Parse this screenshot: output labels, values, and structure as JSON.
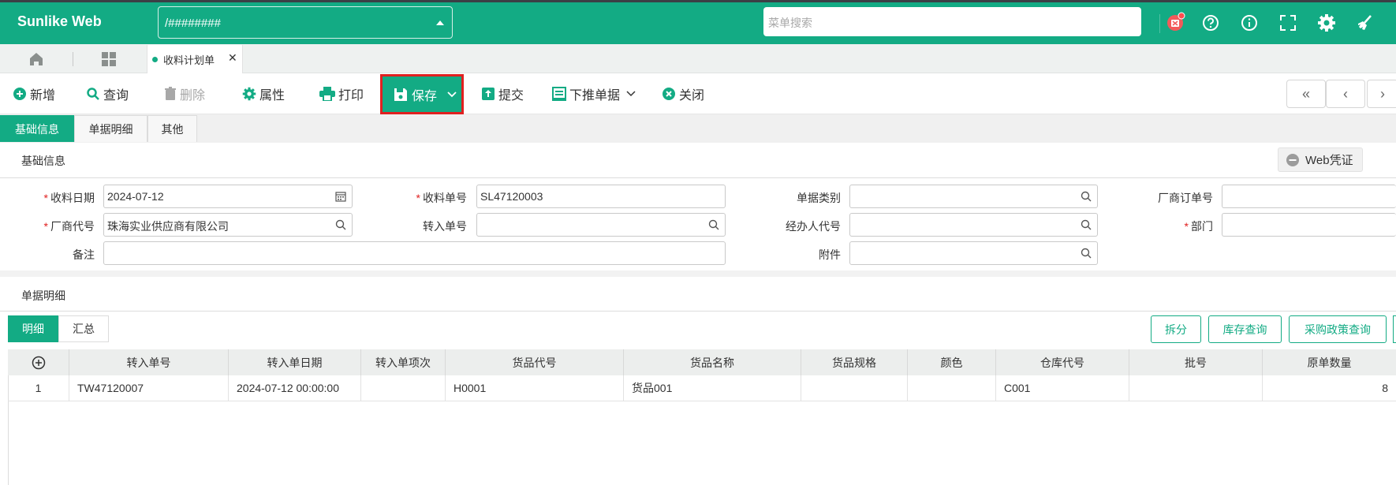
{
  "app": {
    "brand": "Sunlike Web",
    "path_value": "/########",
    "menu_search_placeholder": "菜单搜索"
  },
  "tabs": {
    "page_tab_label": "收料计划单"
  },
  "toolbar": {
    "add": "新增",
    "query": "查询",
    "delete": "删除",
    "properties": "属性",
    "print": "打印",
    "save": "保存",
    "submit": "提交",
    "push_down": "下推单据",
    "close": "关闭"
  },
  "subtabs": [
    "基础信息",
    "单据明细",
    "其他"
  ],
  "basic": {
    "section_title": "基础信息",
    "web_voucher": "Web凭证",
    "fields": {
      "receive_date": {
        "label": "收料日期",
        "value": "2024-07-12"
      },
      "receive_no": {
        "label": "收料单号",
        "value": "SL47120003"
      },
      "doc_type": {
        "label": "单据类别",
        "value": ""
      },
      "vendor_order_no": {
        "label": "厂商订单号",
        "value": ""
      },
      "vendor_code": {
        "label": "厂商代号",
        "value": "珠海实业供应商有限公司"
      },
      "transfer_no": {
        "label": "转入单号",
        "value": ""
      },
      "handler_code": {
        "label": "经办人代号",
        "value": ""
      },
      "department": {
        "label": "部门",
        "value": ""
      },
      "remark": {
        "label": "备注",
        "value": ""
      },
      "attachment": {
        "label": "附件",
        "value": ""
      }
    }
  },
  "detail": {
    "section_title": "单据明细",
    "tabs": [
      "明细",
      "汇总"
    ],
    "actions": [
      "拆分",
      "库存查询",
      "采购政策查询"
    ],
    "columns": [
      "转入单号",
      "转入单日期",
      "转入单项次",
      "货品代号",
      "货品名称",
      "货品规格",
      "颜色",
      "仓库代号",
      "批号",
      "原单数量"
    ],
    "rows": [
      {
        "idx": "1",
        "cells": [
          "TW47120007",
          "2024-07-12 00:00:00",
          "",
          "H0001",
          "货品001",
          "",
          "",
          "C001",
          "",
          "8"
        ]
      }
    ]
  },
  "colors": {
    "accent": "#13ab84",
    "highlight": "#e02020"
  }
}
